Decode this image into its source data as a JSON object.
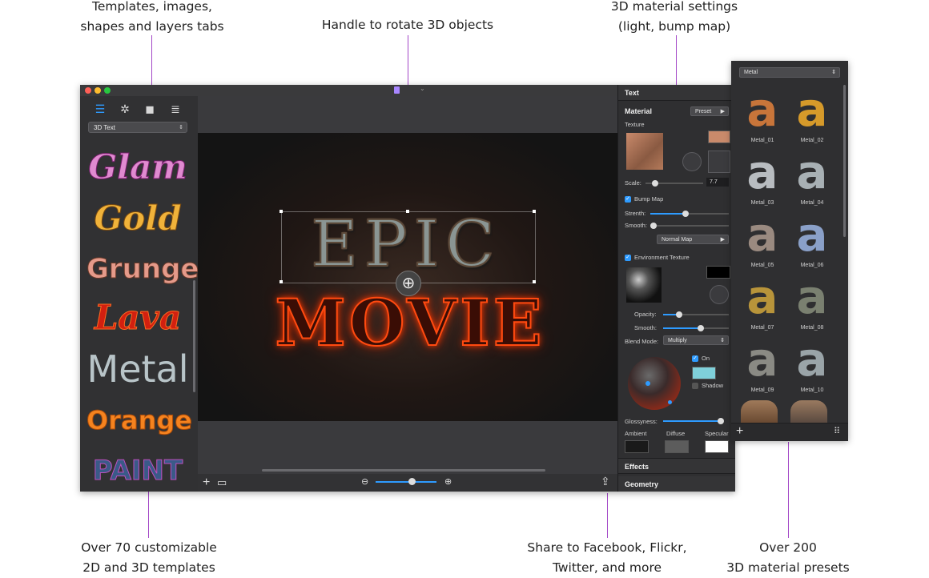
{
  "callouts": {
    "tabs_line1": "Templates, images,",
    "tabs_line2": "shapes and layers tabs",
    "rotate": "Handle to rotate 3D objects",
    "material_line1": "3D material settings",
    "material_line2": "(light, bump map)",
    "templates_line1": "Over 70 customizable",
    "templates_line2": "2D and 3D templates",
    "share_line1": "Share to Facebook, Flickr,",
    "share_line2": "Twitter, and more",
    "presets_line1": "Over 200",
    "presets_line2": "3D material presets"
  },
  "sidebar": {
    "category": "3D Text",
    "templates": [
      "Glam",
      "Gold",
      "Grunge",
      "Lava",
      "Metal",
      "Orange",
      "PAINT"
    ]
  },
  "canvas": {
    "line1": "EPIC",
    "line2": "MOVIE",
    "zoom_level": 0.6
  },
  "inspector": {
    "text_section": "Text",
    "material_section": "Material",
    "preset_button": "Preset",
    "texture_label": "Texture",
    "scale_label": "Scale:",
    "scale_value": "7.7",
    "bump_map_label": "Bump Map",
    "strength_label": "Strenth:",
    "smooth_label": "Smooth:",
    "normal_map_button": "Normal Map",
    "env_texture_label": "Environment Texture",
    "opacity_label": "Opacity:",
    "smooth2_label": "Smooth:",
    "blend_mode_label": "Blend Mode:",
    "blend_mode_value": "Multiply",
    "on_label": "On",
    "shadow_label": "Shadow",
    "glossyness_label": "Glossyness:",
    "ambient_label": "Ambient",
    "diffuse_label": "Diffuse",
    "specular_label": "Specular",
    "effects_section": "Effects",
    "geometry_section": "Geometry",
    "colors": {
      "texture_swatch": "#c98a6b",
      "env_swatch": "#000000",
      "light_swatch": "#7fd0da",
      "ambient": "#1a1a1a",
      "diffuse": "#5c5c5c",
      "specular": "#ffffff"
    }
  },
  "presets": {
    "category": "Metal",
    "items": [
      "Metal_01",
      "Metal_02",
      "Metal_03",
      "Metal_04",
      "Metal_05",
      "Metal_06",
      "Metal_07",
      "Metal_08",
      "Metal_09",
      "Metal_10"
    ]
  },
  "icons": [
    "templates-tab-icon",
    "images-tab-icon",
    "shapes-tab-icon",
    "layers-tab-icon",
    "rotate-handle-icon",
    "add-icon",
    "fit-icon",
    "zoom-out-icon",
    "zoom-in-icon",
    "share-icon",
    "grid-icon"
  ]
}
